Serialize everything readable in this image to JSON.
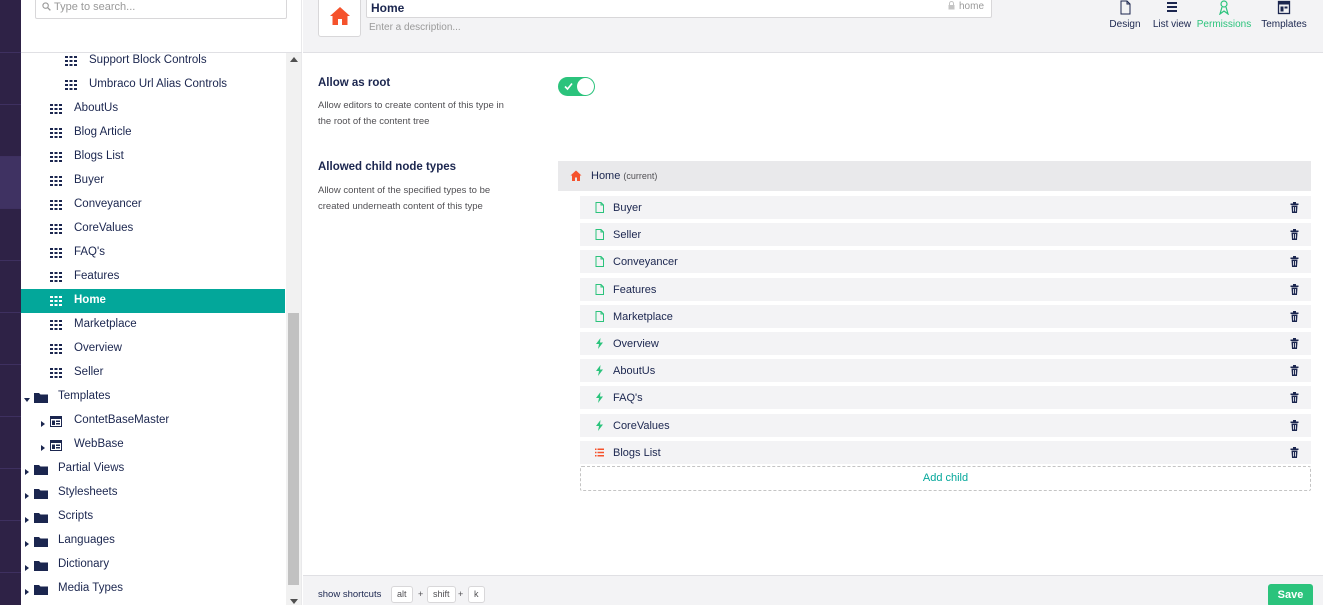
{
  "search": {
    "placeholder": "Type to search..."
  },
  "tree": {
    "items": [
      {
        "label": "Support Block Controls",
        "indent": 2,
        "icon": "grid-icon",
        "caret": false
      },
      {
        "label": "Umbraco Url Alias Controls",
        "indent": 2,
        "icon": "grid-icon",
        "caret": false
      },
      {
        "label": "AboutUs",
        "indent": 1,
        "icon": "grid-icon",
        "caret": false
      },
      {
        "label": "Blog Article",
        "indent": 1,
        "icon": "grid-icon",
        "caret": false
      },
      {
        "label": "Blogs List",
        "indent": 1,
        "icon": "grid-icon",
        "caret": false
      },
      {
        "label": "Buyer",
        "indent": 1,
        "icon": "grid-icon",
        "caret": false
      },
      {
        "label": "Conveyancer",
        "indent": 1,
        "icon": "grid-icon",
        "caret": false
      },
      {
        "label": "CoreValues",
        "indent": 1,
        "icon": "grid-icon",
        "caret": false
      },
      {
        "label": "FAQ's",
        "indent": 1,
        "icon": "grid-icon",
        "caret": false
      },
      {
        "label": "Features",
        "indent": 1,
        "icon": "grid-icon",
        "caret": false
      },
      {
        "label": "Home",
        "indent": 1,
        "icon": "grid-icon",
        "caret": false,
        "selected": true
      },
      {
        "label": "Marketplace",
        "indent": 1,
        "icon": "grid-icon",
        "caret": false
      },
      {
        "label": "Overview",
        "indent": 1,
        "icon": "grid-icon",
        "caret": false
      },
      {
        "label": "Seller",
        "indent": 1,
        "icon": "grid-icon",
        "caret": false
      },
      {
        "label": "Templates",
        "indent": 0,
        "icon": "folder-icon",
        "caret": "down"
      },
      {
        "label": "ContetBaseMaster",
        "indent": 1,
        "icon": "template-icon",
        "caret": "right"
      },
      {
        "label": "WebBase",
        "indent": 1,
        "icon": "template-icon",
        "caret": "right"
      },
      {
        "label": "Partial Views",
        "indent": 0,
        "icon": "folder-icon",
        "caret": "right"
      },
      {
        "label": "Stylesheets",
        "indent": 0,
        "icon": "folder-icon",
        "caret": "right"
      },
      {
        "label": "Scripts",
        "indent": 0,
        "icon": "folder-icon",
        "caret": "right"
      },
      {
        "label": "Languages",
        "indent": 0,
        "icon": "folder-icon",
        "caret": "right"
      },
      {
        "label": "Dictionary",
        "indent": 0,
        "icon": "folder-icon",
        "caret": "right"
      },
      {
        "label": "Media Types",
        "indent": 0,
        "icon": "folder-icon",
        "caret": "right"
      }
    ]
  },
  "header": {
    "name": "Home",
    "alias": "home",
    "description_placeholder": "Enter a description...",
    "tabs": [
      {
        "label": "Design",
        "icon": "document-icon",
        "active": false
      },
      {
        "label": "List view",
        "icon": "list-icon",
        "active": false
      },
      {
        "label": "Permissions",
        "icon": "permissions-icon",
        "active": true
      },
      {
        "label": "Templates",
        "icon": "templates-icon",
        "active": false
      }
    ]
  },
  "content": {
    "allow_root": {
      "label": "Allow as root",
      "description": "Allow editors to create content of this type in the root of the content tree",
      "enabled": true
    },
    "allowed_children": {
      "label": "Allowed child node types",
      "description": "Allow content of the specified types to be created underneath content of this type",
      "current_name": "Home",
      "current_suffix": "(current)",
      "items": [
        {
          "label": "Buyer",
          "icon": "document-icon"
        },
        {
          "label": "Seller",
          "icon": "document-icon"
        },
        {
          "label": "Conveyancer",
          "icon": "document-icon"
        },
        {
          "label": "Features",
          "icon": "document-icon"
        },
        {
          "label": "Marketplace",
          "icon": "document-icon"
        },
        {
          "label": "Overview",
          "icon": "lightning-icon"
        },
        {
          "label": "AboutUs",
          "icon": "lightning-icon"
        },
        {
          "label": "FAQ's",
          "icon": "lightning-icon"
        },
        {
          "label": "CoreValues",
          "icon": "lightning-icon"
        },
        {
          "label": "Blogs List",
          "icon": "list-bullets-icon"
        }
      ],
      "add_label": "Add child"
    }
  },
  "footer": {
    "shortcuts_label": "show shortcuts",
    "keys": [
      "alt",
      "shift",
      "k"
    ],
    "save_label": "Save"
  },
  "colors": {
    "accent": "#03a79a",
    "success": "#2bc37c",
    "home_icon": "#f5522c",
    "rail": "#2e2246"
  }
}
